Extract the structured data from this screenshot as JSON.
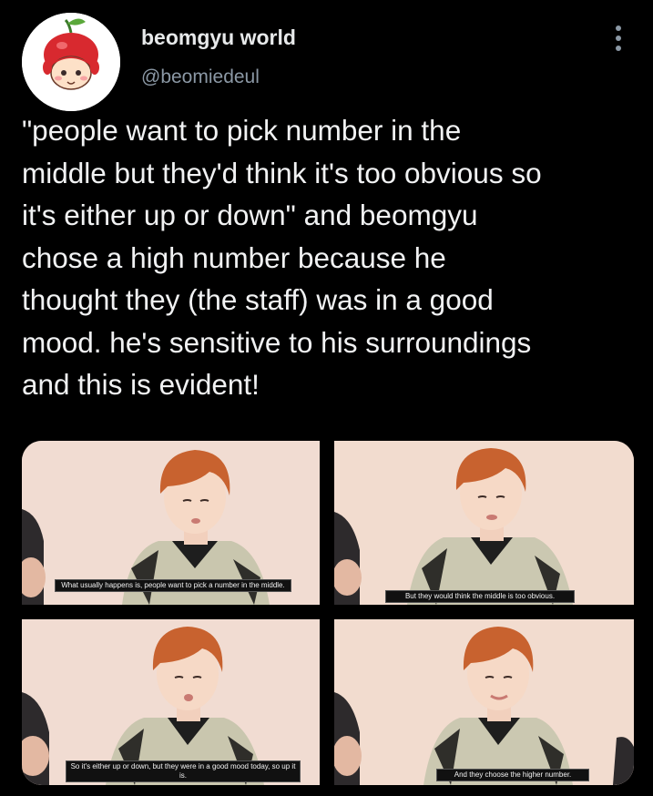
{
  "author": {
    "display_name": "beomgyu world",
    "handle": "@beomiedeul",
    "avatar_icon": "cherry-character-avatar"
  },
  "menu": {
    "icon": "more-vertical-icon"
  },
  "tweet": {
    "text": "\"people want to pick number in the\nmiddle but they'd think it's too obvious so\nit's either up or down\" and beomgyu\nchose a high number because he\nthought they (the staff) was in a good\nmood. he's sensitive to his surroundings\nand this is evident!"
  },
  "media": {
    "frames": [
      {
        "caption": "What usually happens is, people want to pick a number in the middle."
      },
      {
        "caption": "But they would think the middle is too obvious."
      },
      {
        "caption": "So it's either up or down, but they were in a good mood today, so up it is."
      },
      {
        "caption": "And they choose the higher number."
      }
    ]
  },
  "colors": {
    "background": "#000000",
    "text": "#e7e9ea",
    "secondary_text": "#8b98a5",
    "photo_background": "#f1dcd2",
    "hair": "#c8622f"
  }
}
